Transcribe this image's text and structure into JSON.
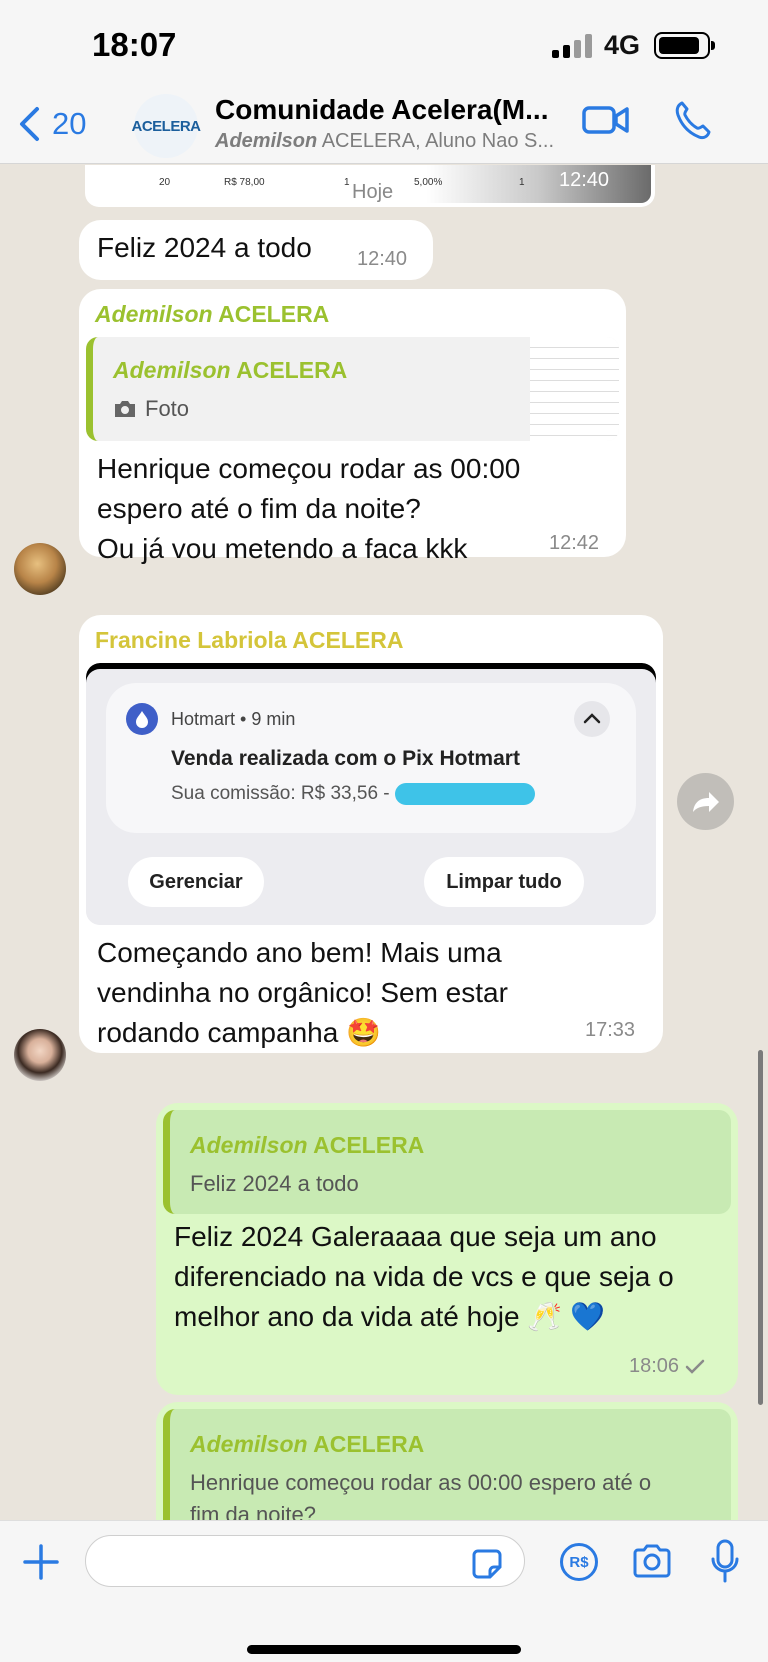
{
  "status_bar": {
    "time": "18:07",
    "network": "4G"
  },
  "header": {
    "back_count": "20",
    "avatar_text": "ACELERA",
    "title": "Comunidade Acelera(M...",
    "subtitle_bold": "Ademilson",
    "subtitle_rest": " ACELERA, Aluno Nao S..."
  },
  "chat": {
    "top_sheet": {
      "cells": [
        "20",
        "R$ 78,00",
        "1",
        "5,00%",
        "1"
      ],
      "time": "12:40"
    },
    "date_chip": "Hoje",
    "msg1": {
      "text": "Feliz 2024 a todo",
      "time": "12:40"
    },
    "msg2": {
      "sender_first": "Ademilson",
      "sender_rest": " ACELERA",
      "sender_color": "#9bc12f",
      "quote_sender_first": "Ademilson",
      "quote_sender_rest": " ACELERA",
      "quote_text": "Foto",
      "text_line1": "Henrique começou rodar as 00:00",
      "text_line2": "espero até o fim da noite?",
      "text_line3": "Ou já vou metendo a faca kkk",
      "time": "12:42"
    },
    "msg3": {
      "sender": "Francine Labriola ACELERA",
      "sender_color": "#d4c53a",
      "notification": {
        "app": "Hotmart • 9 min",
        "title": "Venda realizada com o Pix Hotmart",
        "body": "Sua comissão: R$ 33,56 - ",
        "manage_label": "Gerenciar",
        "clear_label": "Limpar tudo"
      },
      "text_line1": "Começando ano bem! Mais uma",
      "text_line2": "vendinha no orgânico! Sem estar",
      "text_line3": "rodando campanha 🤩",
      "time": "17:33"
    },
    "msg4": {
      "quote_sender_first": "Ademilson",
      "quote_sender_rest": " ACELERA",
      "quote_text": "Feliz 2024 a todo",
      "text_line1": "Feliz 2024 Galeraaaa que seja um ano",
      "text_line2": "diferenciado na vida de vcs e que seja o",
      "text_line3": "melhor ano da vida até hoje 🥂 💙",
      "time": "18:06"
    },
    "msg5": {
      "quote_sender_first": "Ademilson",
      "quote_sender_rest": " ACELERA",
      "quote_line1": "Henrique começou rodar as 00:00 espero até o",
      "quote_line2": "fim da noite?"
    }
  },
  "input_bar": {
    "placeholder": "",
    "pay_label": "R$"
  },
  "colors": {
    "accent": "#2a7ae2",
    "outgoing_bubble": "#dcf8c6",
    "chat_bg": "#e9e4dc"
  }
}
